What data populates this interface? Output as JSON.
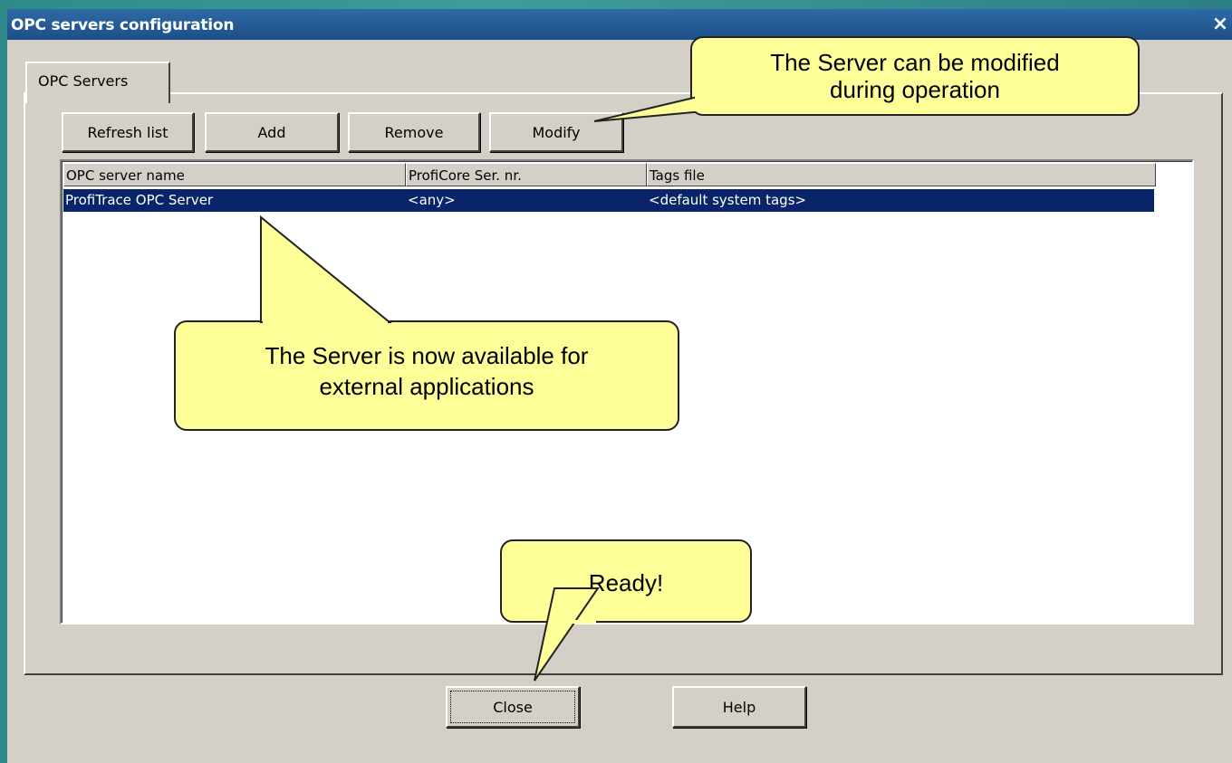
{
  "window": {
    "title": "OPC servers configuration",
    "close_glyph": "×"
  },
  "tabs": [
    {
      "label": "OPC Servers",
      "active": true
    }
  ],
  "toolbar": {
    "refresh_label": "Refresh list",
    "add_label": "Add",
    "remove_label": "Remove",
    "modify_label": "Modify"
  },
  "table": {
    "columns": [
      "OPC server name",
      "ProfiCore Ser. nr.",
      "Tags file"
    ],
    "rows": [
      {
        "name": "ProfiTrace OPC Server",
        "serial": "<any>",
        "tags_file": "<default system tags>",
        "selected": true
      }
    ]
  },
  "footer": {
    "close_label": "Close",
    "help_label": "Help"
  },
  "callouts": {
    "modify_note_line1": "The Server can be modified",
    "modify_note_line2": "during operation",
    "available_note_line1": "The Server is now available for",
    "available_note_line2": "external applications",
    "ready_note": "Ready!"
  },
  "colors": {
    "selection": "#0a246a",
    "callout_fill": "#ffff99",
    "dialog_bg": "#d4d0c8",
    "titlebar": "#1d4f88"
  }
}
